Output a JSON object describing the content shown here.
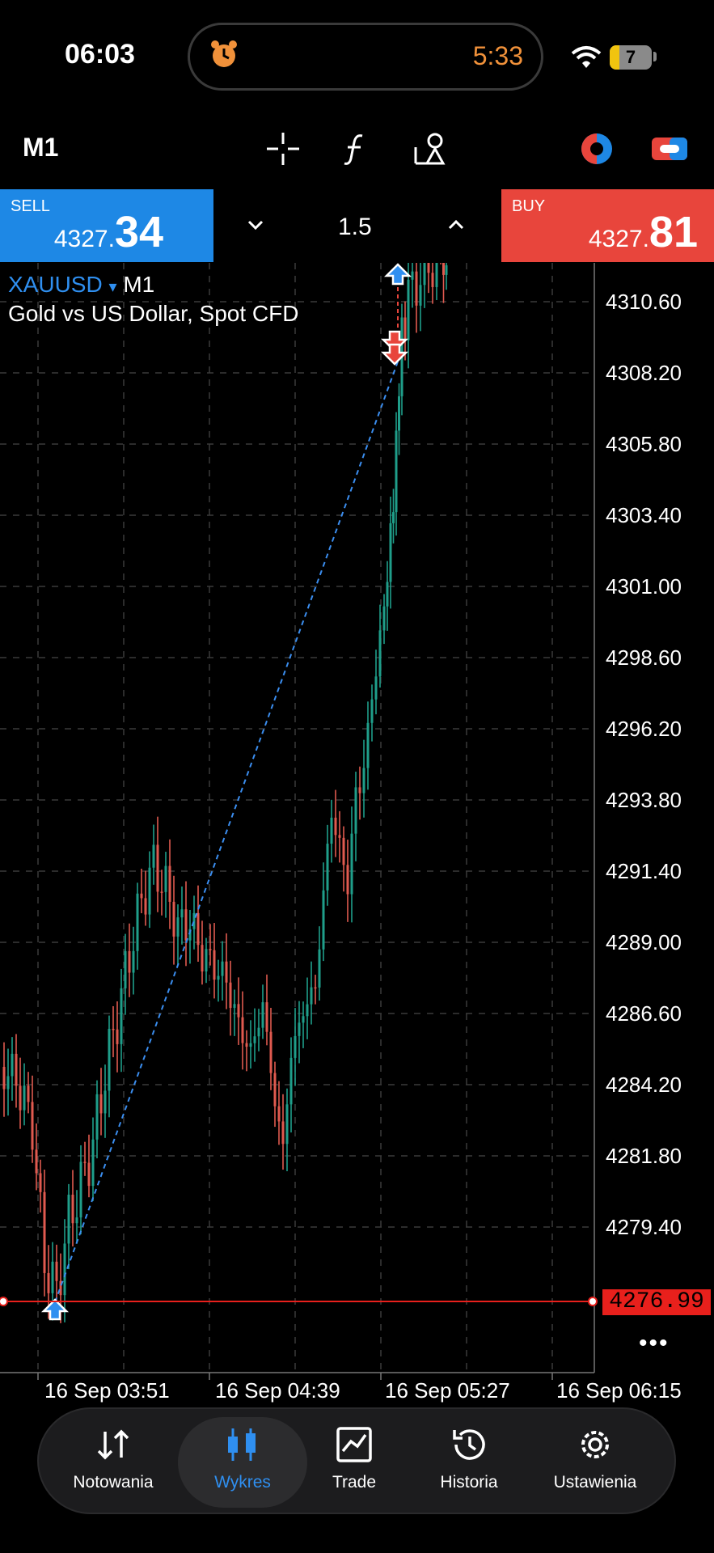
{
  "status_bar": {
    "time": "06:03",
    "timer": "5:33",
    "battery": "7"
  },
  "toolbar": {
    "timeframe": "M1",
    "icons": [
      "crosshair-icon",
      "function-icon",
      "objects-icon",
      "color-theme-icon",
      "toggle-icon"
    ]
  },
  "trade": {
    "sell_label": "SELL",
    "sell_price_small": "4327.",
    "sell_price_big": "34",
    "buy_label": "BUY",
    "buy_price_small": "4327.",
    "buy_price_big": "81",
    "volume": "1.5"
  },
  "chart": {
    "symbol": "XAUUSD",
    "symbol_arrow": "▾",
    "timeframe": "M1",
    "description": "Gold vs US Dollar, Spot CFD",
    "current_price": "4276.99",
    "y_labels": [
      "4310.60",
      "4308.20",
      "4305.80",
      "4303.40",
      "4301.00",
      "4298.60",
      "4296.20",
      "4293.80",
      "4291.40",
      "4289.00",
      "4286.60",
      "4284.20",
      "4281.80",
      "4279.40"
    ],
    "x_labels": [
      "16 Sep 03:51",
      "16 Sep 04:39",
      "16 Sep 05:27",
      "16 Sep 06:15"
    ],
    "more": "•••"
  },
  "nav": {
    "items": [
      {
        "label": "Notowania",
        "icon": "quotes-icon"
      },
      {
        "label": "Wykres",
        "icon": "chart-icon"
      },
      {
        "label": "Trade",
        "icon": "trade-icon"
      },
      {
        "label": "Historia",
        "icon": "history-icon"
      },
      {
        "label": "Ustawienia",
        "icon": "settings-icon"
      }
    ],
    "active": "Wykres"
  },
  "colors": {
    "buy": "#e8453c",
    "sell": "#1e88e5",
    "accent": "#2f8ff0",
    "bull": "#1f9e8a",
    "bear": "#e05a4f"
  }
}
